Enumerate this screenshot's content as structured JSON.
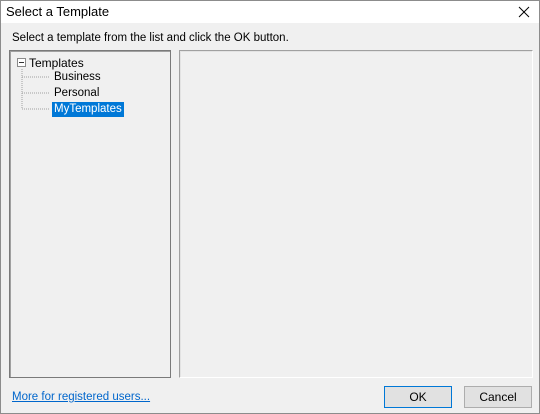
{
  "window": {
    "title": "Select a Template",
    "close_label": "×"
  },
  "instruction": "Select a template from the list and click the OK button.",
  "tree": {
    "root": "Templates",
    "items": [
      {
        "label": "Business",
        "selected": false
      },
      {
        "label": "Personal",
        "selected": false
      },
      {
        "label": "MyTemplates",
        "selected": true
      }
    ]
  },
  "footer": {
    "link_label": "More for registered users...",
    "ok_label": "OK",
    "cancel_label": "Cancel"
  },
  "colors": {
    "selection": "#0078d7",
    "link": "#0066cc"
  }
}
